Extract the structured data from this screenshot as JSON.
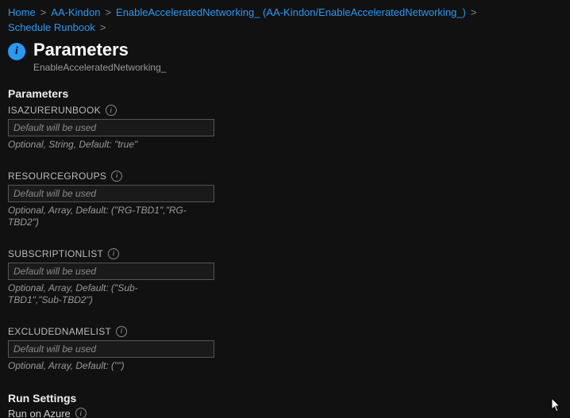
{
  "breadcrumb": {
    "items": [
      {
        "label": "Home"
      },
      {
        "label": "AA-Kindon"
      },
      {
        "label": "EnableAcceleratedNetworking_ (AA-Kindon/EnableAcceleratedNetworking_)"
      },
      {
        "label": "Schedule Runbook"
      }
    ],
    "separator": ">"
  },
  "header": {
    "title": "Parameters",
    "subtitle": "EnableAcceleratedNetworking_"
  },
  "sections": {
    "parameters_heading": "Parameters",
    "run_settings_heading": "Run Settings",
    "run_on_label": "Run on Azure"
  },
  "params": [
    {
      "label": "ISAZURERUNBOOK",
      "placeholder": "Default will be used",
      "help": "Optional, String, Default: \"true\""
    },
    {
      "label": "RESOURCEGROUPS",
      "placeholder": "Default will be used",
      "help": "Optional, Array, Default: (\"RG-TBD1\",\"RG-TBD2\")"
    },
    {
      "label": "SUBSCRIPTIONLIST",
      "placeholder": "Default will be used",
      "help": "Optional, Array, Default: (\"Sub-TBD1\",\"Sub-TBD2\")"
    },
    {
      "label": "EXCLUDEDNAMELIST",
      "placeholder": "Default will be used",
      "help": "Optional, Array, Default: (\"\")"
    }
  ]
}
